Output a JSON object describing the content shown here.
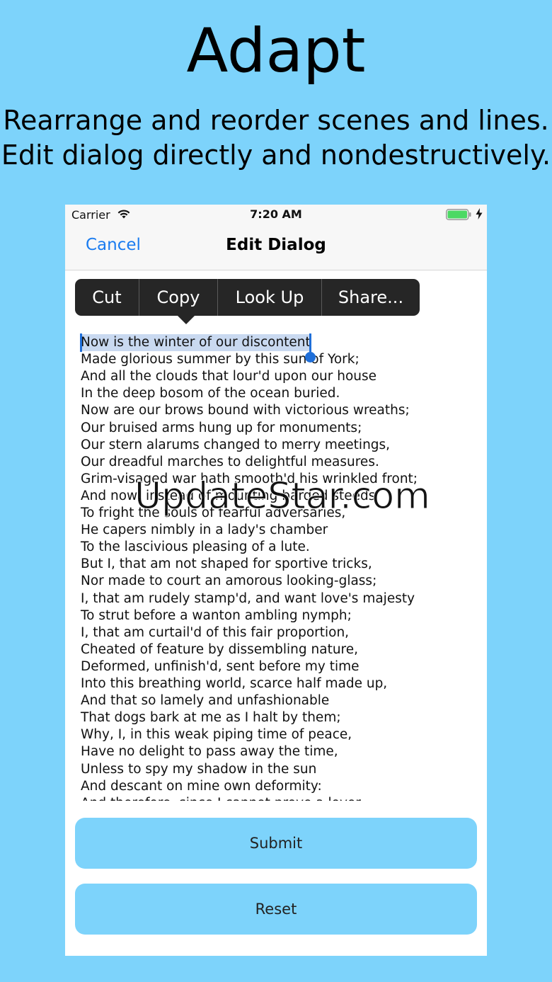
{
  "hero": {
    "title": "Adapt",
    "subtitle_line1": "Rearrange and reorder scenes and lines.",
    "subtitle_line2": "Edit dialog directly and nondestructively."
  },
  "status_bar": {
    "carrier": "Carrier",
    "time": "7:20 AM",
    "wifi_icon": "wifi-icon",
    "battery_icon": "battery-icon",
    "battery_color": "#4cd964",
    "charging_icon": "bolt-icon"
  },
  "nav": {
    "cancel_label": "Cancel",
    "title": "Edit Dialog",
    "accent_color": "#1a7cf0"
  },
  "edit_menu": {
    "items": [
      "Cut",
      "Copy",
      "Look Up",
      "Share..."
    ]
  },
  "selection": {
    "selected_text": "Now is the winter of our discontent"
  },
  "dialog_lines": [
    "Now is the winter of our discontent",
    "Made glorious summer by this sun of York;",
    "And all the clouds that lour'd upon our house",
    "In the deep bosom of the ocean buried.",
    "Now are our brows bound with victorious wreaths;",
    "Our bruised arms hung up for monuments;",
    "Our stern alarums changed to merry meetings,",
    "Our dreadful marches to delightful measures.",
    "Grim-visaged war hath smooth'd his wrinkled front;",
    "And now, instead of mounting barded steeds",
    "To fright the souls of fearful adversaries,",
    "He capers nimbly in a lady's chamber",
    "To the lascivious pleasing of a lute.",
    "But I, that am not shaped for sportive tricks,",
    "Nor made to court an amorous looking-glass;",
    "I, that am rudely stamp'd, and want love's majesty",
    "To strut before a wanton ambling nymph;",
    "I, that am curtail'd of this fair proportion,",
    "Cheated of feature by dissembling nature,",
    "Deformed, unfinish'd, sent before my time",
    "Into this breathing world, scarce half made up,",
    "And that so lamely and unfashionable",
    "That dogs bark at me as I halt by them;",
    "Why, I, in this weak piping time of peace,",
    "Have no delight to pass away the time,",
    "Unless to spy my shadow in the sun",
    "And descant on mine own deformity:",
    "And therefore, since I cannot prove a lover,"
  ],
  "watermark": "UpdateStar.com",
  "buttons": {
    "submit_label": "Submit",
    "reset_label": "Reset",
    "button_color": "#7dd3fb"
  }
}
